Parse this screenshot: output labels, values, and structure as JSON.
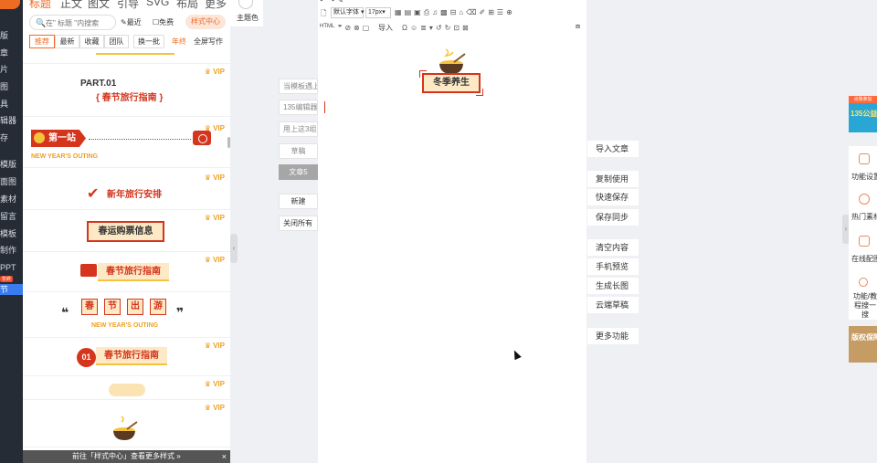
{
  "left_nav": {
    "items": [
      "版",
      "章",
      "片",
      "图",
      "具",
      "辑器",
      "存",
      "模版",
      "面图",
      "素材",
      "留言",
      "模板",
      "制作",
      "PPT",
      "节"
    ],
    "hot_badge": "年终"
  },
  "panel": {
    "tabs": [
      "标题",
      "正文",
      "图文",
      "引导",
      "SVG",
      "布局",
      "更多"
    ],
    "active_tab": "标题",
    "search_placeholder": "在\" 标题 \"内搜索",
    "recent": "最近",
    "free": "免费",
    "style_center": "样式中心",
    "subtabs": [
      "推荐",
      "最新",
      "收藏",
      "团队"
    ],
    "active_subtab": "推荐",
    "swap": "换一批",
    "year_end": "年终",
    "fullscreen": "全屏写作",
    "vip": "VIP",
    "templates": {
      "part_label": "PART.01",
      "spring_guide_bracket": "{ 春节旅行指南 }",
      "first_station": "第一站",
      "new_year_outing": "NEW YEAR'S OUTING",
      "travel_plan": "新年旅行安排",
      "ticket_info": "春运购票信息",
      "spring_guide": "春节旅行指南",
      "chars": [
        "春",
        "节",
        "出",
        "游"
      ],
      "num_01": "01"
    },
    "popup_text": "前往「样式中心」查看更多样式 »",
    "popup_close": "×"
  },
  "theme": {
    "label": "主题色"
  },
  "drafts": [
    "当模板遇上",
    "135编辑器",
    "用上这3组",
    "草稿",
    "文章5",
    "新建",
    "关闭所有"
  ],
  "active_draft": "文章5",
  "editor": {
    "font": "默认字体",
    "size": "17px",
    "html_label": "HTML",
    "import_label": "导入",
    "winter_title": "冬季养生"
  },
  "actions": [
    "导入文章",
    "复制使用",
    "快速保存",
    "保存同步",
    "清空内容",
    "手机预览",
    "生成长图",
    "云端草稿",
    "更多功能"
  ],
  "right_sidebar": {
    "items": [
      "功能设置",
      "热门素材",
      "在线配图",
      "功能/教程搜一搜"
    ],
    "promo_top": "点我参加",
    "promo_text": "135公益",
    "copyright": "版权保障企业会员"
  }
}
